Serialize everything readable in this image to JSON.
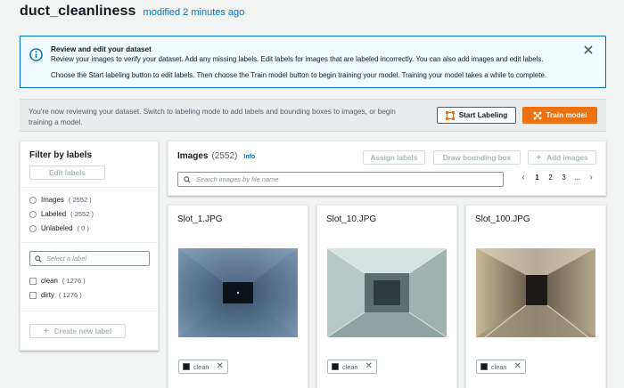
{
  "header": {
    "title": "duct_cleanliness",
    "modified": "modified 2 minutes ago"
  },
  "info_box": {
    "heading": "Review and edit your dataset",
    "line1": "Review your images to verify your dataset. Add any missing labels. Edit labels for images that are labeled incorrectly. You can also add images and edit labels.",
    "line2": "Choose the Start labeling button to edit labels. Then choose the Train model button to begin training your model. Training your model takes a while to complete."
  },
  "review_bar": {
    "message": "You're now reviewing your dataset. Switch to labeling mode to add labels and bounding boxes to images, or begin training a model.",
    "start_label": "Start Labeling",
    "train_label": "Train model"
  },
  "filter": {
    "title": "Filter by labels",
    "edit_label": "Edit labels",
    "radios": [
      {
        "label": "Images",
        "count": "( 2552 )"
      },
      {
        "label": "Labeled",
        "count": "( 2552 )"
      },
      {
        "label": "Unlabeled",
        "count": "( 0 )"
      }
    ],
    "search_placeholder": "Select a label",
    "labels": [
      {
        "label": "clean",
        "count": "( 1276 )"
      },
      {
        "label": "dirty",
        "count": "( 1276 )"
      }
    ],
    "create_label": "Create new label"
  },
  "images": {
    "title": "Images",
    "count": "(2552)",
    "info": "Info",
    "assign_label": "Assign labels",
    "draw_label": "Draw bounding box",
    "add_label": "Add images",
    "search_placeholder": "Search images by file name",
    "pages": [
      "1",
      "2",
      "3",
      "..."
    ]
  },
  "cards": [
    {
      "filename": "Slot_1.JPG",
      "tag": "clean"
    },
    {
      "filename": "Slot_10.JPG",
      "tag": "clean"
    },
    {
      "filename": "Slot_100.JPG",
      "tag": "clean"
    }
  ],
  "colors": {
    "accent": "#0073bb",
    "primary": "#ec7211",
    "background": "#f2f3f3"
  }
}
